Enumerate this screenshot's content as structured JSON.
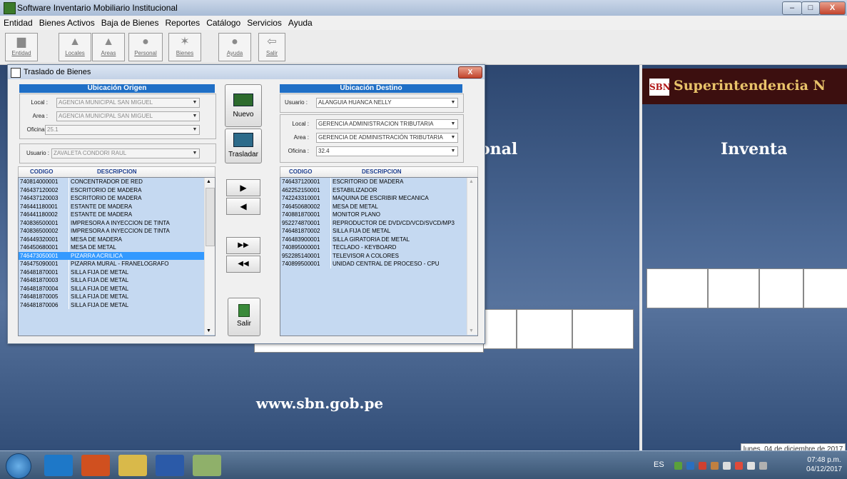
{
  "window": {
    "title": "Software Inventario Mobiliario Institucional",
    "min": "–",
    "max": "□",
    "close": "X"
  },
  "menu": [
    "Entidad",
    "Bienes Activos",
    "Baja de Bienes",
    "Reportes",
    "Catálogo",
    "Servicios",
    "Ayuda"
  ],
  "toolbar": [
    {
      "label": "Entidad",
      "icon": "building-icon"
    },
    {
      "label": "Locales",
      "icon": "locales-icon"
    },
    {
      "label": "Areas",
      "icon": "areas-icon"
    },
    {
      "label": "Personal",
      "icon": "personal-icon"
    },
    {
      "label": "Bienes",
      "icon": "bienes-icon"
    },
    {
      "label": "Ayuda",
      "icon": "help-icon"
    },
    {
      "label": "Salir",
      "icon": "exit-icon"
    }
  ],
  "background": {
    "sbn_logo": "SBN",
    "sbn_title": "Superintendencia N",
    "heading_right": "Inventa",
    "heading_left": "onal",
    "website": "www.sbn.gob.pe",
    "date": "lunes, 04 de diciembre de 2017"
  },
  "dialog": {
    "title": "Traslado de Bienes",
    "close": "X",
    "origen": {
      "header": "Ubicación Origen",
      "local_label": "Local :",
      "local_value": "AGENCIA MUNICIPAL SAN MIGUEL",
      "area_label": "Area :",
      "area_value": "AGENCIA MUNICIPAL SAN MIGUEL",
      "oficina_label": "Oficina :",
      "oficina_value": "25.1",
      "usuario_label": "Usuario :",
      "usuario_value": "ZAVALETA CONDORI RAUL"
    },
    "destino": {
      "header": "Ubicación Destino",
      "usuario_label": "Usuario :",
      "usuario_value": "ALANGUIA HUANCA NELLY",
      "local_label": "Local :",
      "local_value": "GERENCIA ADMINISTRACION TRIBUTARIA",
      "area_label": "Area :",
      "area_value": "GERENCIA DE ADMINISTRACIÓN TRIBUTARIA",
      "oficina_label": "Oficina :",
      "oficina_value": "32.4"
    },
    "buttons": {
      "nuevo": "Nuevo",
      "trasladar": "Trasladar",
      "salir": "Salir",
      "move_one": "▶",
      "back_one": "◀",
      "move_all": "▶▶",
      "back_all": "◀◀"
    },
    "columns": {
      "codigo": "CODIGO",
      "descripcion": "DESCRIPCION"
    },
    "left_rows": [
      {
        "code": "740814000001",
        "desc": "CONCENTRADOR DE RED"
      },
      {
        "code": "746437120002",
        "desc": "ESCRITORIO DE MADERA"
      },
      {
        "code": "746437120003",
        "desc": "ESCRITORIO DE MADERA"
      },
      {
        "code": "746441180001",
        "desc": "ESTANTE DE MADERA"
      },
      {
        "code": "746441180002",
        "desc": "ESTANTE DE MADERA"
      },
      {
        "code": "740836500001",
        "desc": "IMPRESORA A INYECCION DE TINTA"
      },
      {
        "code": "740836500002",
        "desc": "IMPRESORA A INYECCION DE TINTA"
      },
      {
        "code": "746449320001",
        "desc": "MESA DE MADERA"
      },
      {
        "code": "746450680001",
        "desc": "MESA DE METAL"
      },
      {
        "code": "746473050001",
        "desc": "PIZARRA ACRILICA",
        "selected": true
      },
      {
        "code": "746475090001",
        "desc": "PIZARRA MURAL - FRANELOGRAFO"
      },
      {
        "code": "746481870001",
        "desc": "SILLA FIJA DE METAL"
      },
      {
        "code": "746481870003",
        "desc": "SILLA FIJA DE METAL"
      },
      {
        "code": "746481870004",
        "desc": "SILLA FIJA DE METAL"
      },
      {
        "code": "746481870005",
        "desc": "SILLA FIJA DE METAL"
      },
      {
        "code": "746481870006",
        "desc": "SILLA FIJA DE METAL"
      }
    ],
    "right_rows": [
      {
        "code": "746437120001",
        "desc": "ESCRITORIO DE MADERA"
      },
      {
        "code": "462252150001",
        "desc": "ESTABILIZADOR"
      },
      {
        "code": "742243310001",
        "desc": "MAQUINA DE ESCRIBIR MECANICA"
      },
      {
        "code": "746450680002",
        "desc": "MESA DE METAL"
      },
      {
        "code": "740881870001",
        "desc": "MONITOR PLANO"
      },
      {
        "code": "952274870001",
        "desc": "REPRODUCTOR DE DVD/CD/VCD/SVCD/MP3"
      },
      {
        "code": "746481870002",
        "desc": "SILLA FIJA DE METAL"
      },
      {
        "code": "746483900001",
        "desc": "SILLA GIRATORIA DE METAL"
      },
      {
        "code": "740895000001",
        "desc": "TECLADO - KEYBOARD"
      },
      {
        "code": "952285140001",
        "desc": "TELEVISOR A COLORES"
      },
      {
        "code": "740899500001",
        "desc": "UNIDAD CENTRAL DE PROCESO - CPU"
      }
    ]
  },
  "taskbar": {
    "lang": "ES",
    "time": "07:48 p.m.",
    "date": "04/12/2017"
  }
}
